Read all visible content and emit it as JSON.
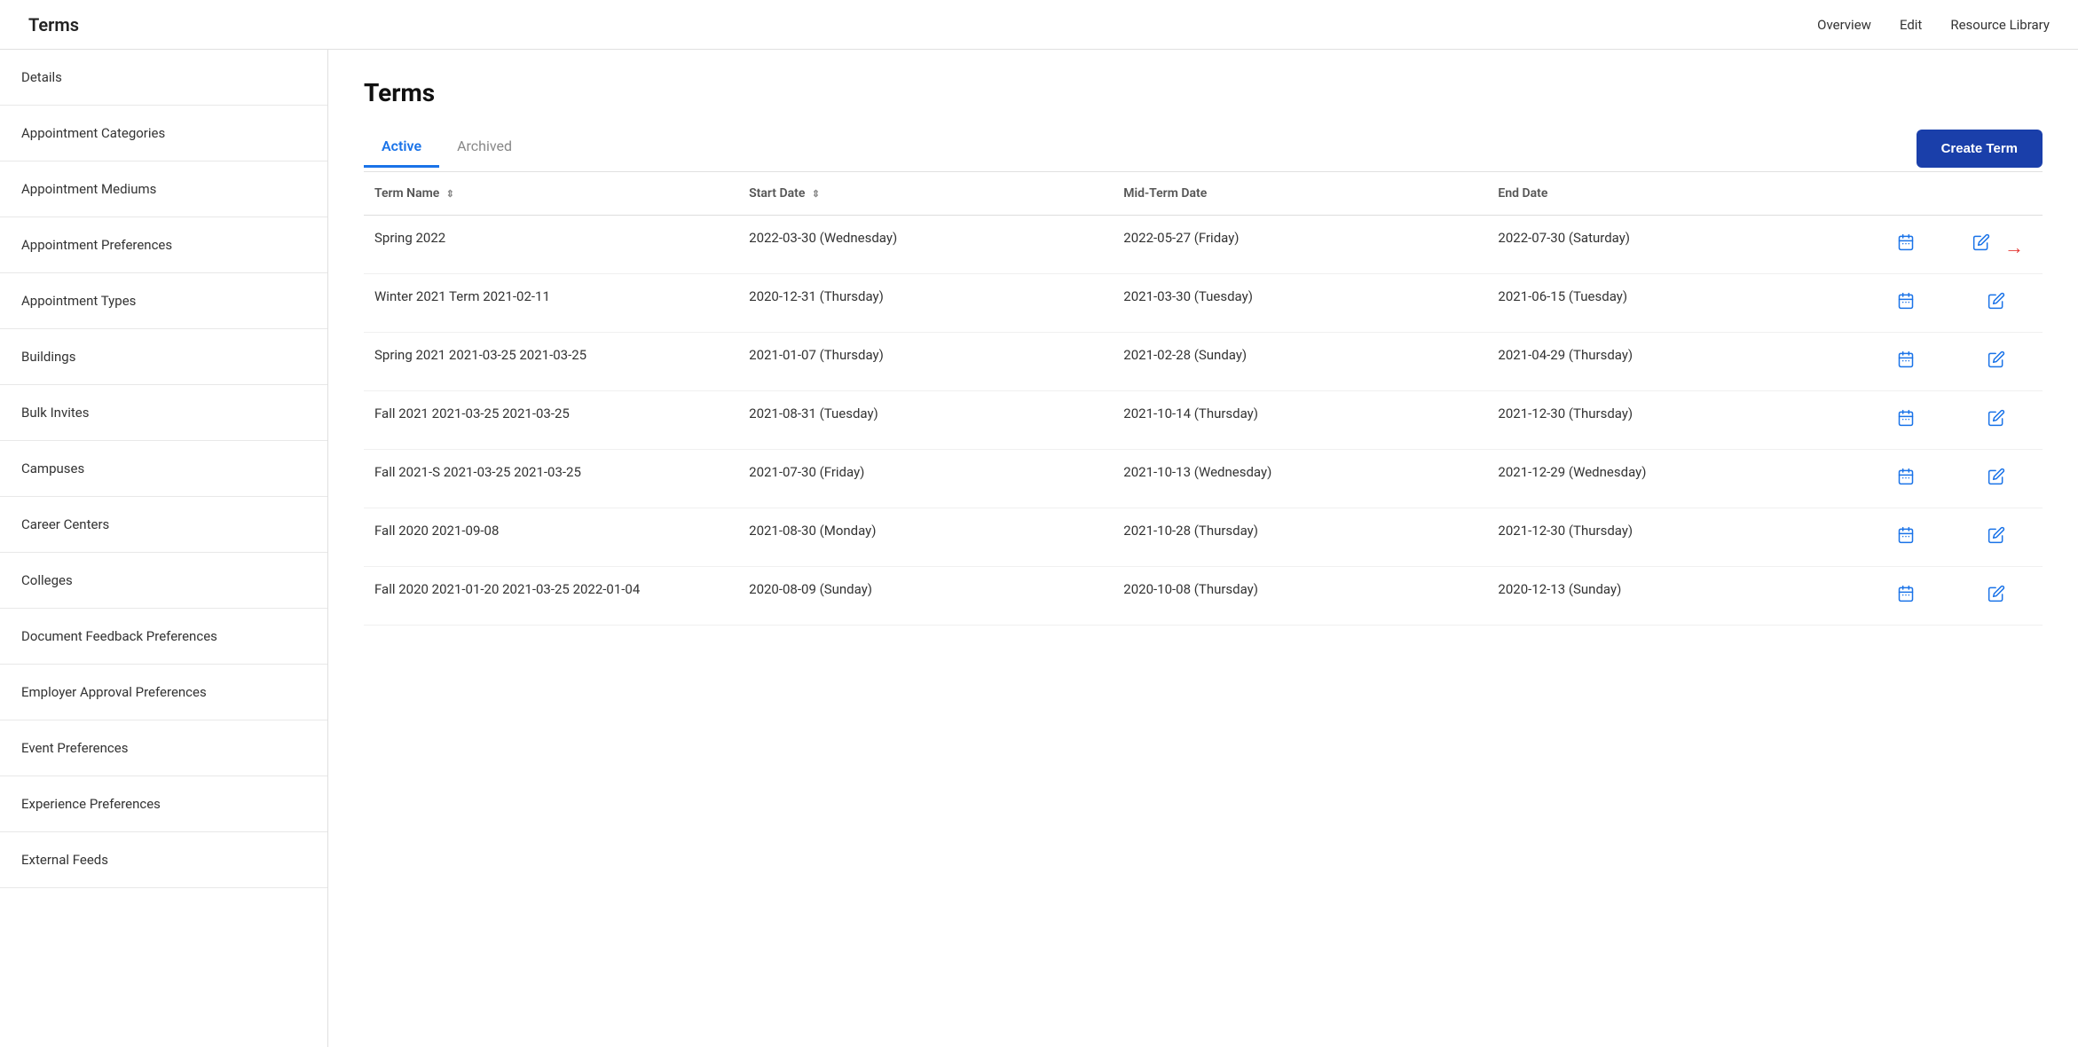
{
  "topBar": {
    "title": "Terms",
    "nav": [
      "Overview",
      "Edit",
      "Resource Library"
    ]
  },
  "sidebar": {
    "items": [
      {
        "label": "Details"
      },
      {
        "label": "Appointment Categories"
      },
      {
        "label": "Appointment Mediums"
      },
      {
        "label": "Appointment Preferences"
      },
      {
        "label": "Appointment Types"
      },
      {
        "label": "Buildings"
      },
      {
        "label": "Bulk Invites"
      },
      {
        "label": "Campuses"
      },
      {
        "label": "Career Centers"
      },
      {
        "label": "Colleges"
      },
      {
        "label": "Document Feedback Preferences"
      },
      {
        "label": "Employer Approval Preferences"
      },
      {
        "label": "Event Preferences"
      },
      {
        "label": "Experience Preferences"
      },
      {
        "label": "External Feeds"
      }
    ]
  },
  "main": {
    "pageTitle": "Terms",
    "tabs": [
      {
        "label": "Active",
        "active": true
      },
      {
        "label": "Archived",
        "active": false
      }
    ],
    "createButton": "Create Term",
    "tableHeaders": [
      {
        "label": "Term Name",
        "sortable": true
      },
      {
        "label": "Start Date",
        "sortable": true
      },
      {
        "label": "Mid-Term Date",
        "sortable": false
      },
      {
        "label": "End Date",
        "sortable": false
      },
      {
        "label": "",
        "sortable": false
      },
      {
        "label": "",
        "sortable": false
      }
    ],
    "rows": [
      {
        "name": "Spring 2022",
        "startDate": "2022-03-30 (Wednesday)",
        "midTermDate": "2022-05-27 (Friday)",
        "endDate": "2022-07-30 (Saturday)",
        "hasArrow": true
      },
      {
        "name": "Winter 2021 Term 2021-02-11",
        "startDate": "2020-12-31 (Thursday)",
        "midTermDate": "2021-03-30 (Tuesday)",
        "endDate": "2021-06-15 (Tuesday)",
        "hasArrow": false
      },
      {
        "name": "Spring 2021 2021-03-25 2021-03-25",
        "startDate": "2021-01-07 (Thursday)",
        "midTermDate": "2021-02-28 (Sunday)",
        "endDate": "2021-04-29 (Thursday)",
        "hasArrow": false
      },
      {
        "name": "Fall 2021 2021-03-25 2021-03-25",
        "startDate": "2021-08-31 (Tuesday)",
        "midTermDate": "2021-10-14 (Thursday)",
        "endDate": "2021-12-30 (Thursday)",
        "hasArrow": false
      },
      {
        "name": "Fall 2021-S 2021-03-25 2021-03-25",
        "startDate": "2021-07-30 (Friday)",
        "midTermDate": "2021-10-13 (Wednesday)",
        "endDate": "2021-12-29 (Wednesday)",
        "hasArrow": false
      },
      {
        "name": "Fall 2020 2021-09-08",
        "startDate": "2021-08-30 (Monday)",
        "midTermDate": "2021-10-28 (Thursday)",
        "endDate": "2021-12-30 (Thursday)",
        "hasArrow": false
      },
      {
        "name": "Fall 2020 2021-01-20 2021-03-25 2022-01-04",
        "startDate": "2020-08-09 (Sunday)",
        "midTermDate": "2020-10-08 (Thursday)",
        "endDate": "2020-12-13 (Sunday)",
        "hasArrow": false
      }
    ]
  }
}
